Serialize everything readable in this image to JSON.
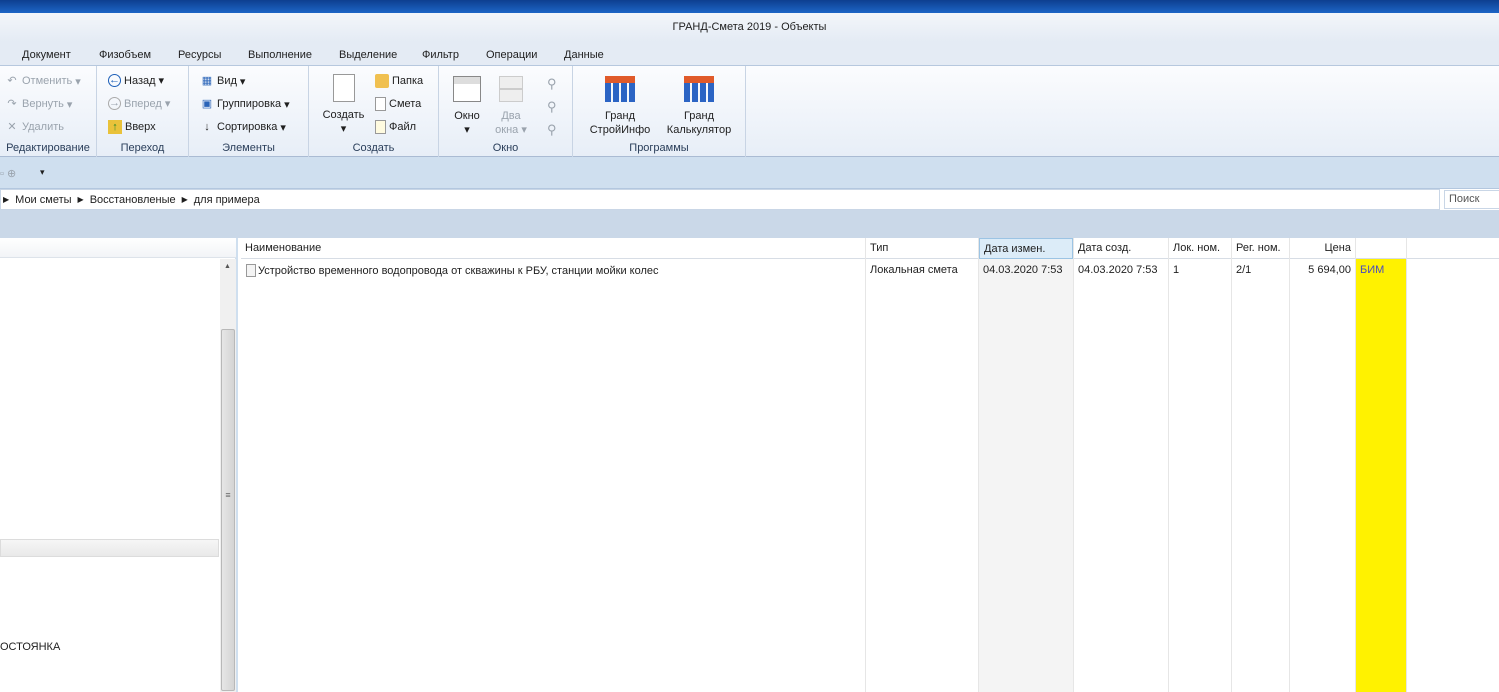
{
  "window": {
    "title": "ГРАНД-Смета 2019 - Объекты"
  },
  "menu": [
    "Документ",
    "Физобъем",
    "Ресурсы",
    "Выполнение",
    "Выделение",
    "Фильтр",
    "Операции",
    "Данные"
  ],
  "ribbon": {
    "edit": {
      "label": "Редактирование",
      "undo": "Отменить",
      "redo": "Вернуть",
      "delete": "Удалить"
    },
    "nav": {
      "label": "Переход",
      "back": "Назад",
      "forward": "Вперед",
      "up": "Вверх"
    },
    "elements": {
      "label": "Элементы",
      "view": "Вид",
      "group": "Группировка",
      "sort": "Сортировка"
    },
    "create": {
      "label": "Создать",
      "create": "Создать",
      "folder": "Папка",
      "estimate": "Смета",
      "file": "Файл"
    },
    "window": {
      "label": "Окно",
      "window": "Окно",
      "two1": "Два",
      "two2": "окна"
    },
    "programs": {
      "label": "Программы",
      "p1a": "Гранд",
      "p1b": "СтройИнфо",
      "p2a": "Гранд",
      "p2b": "Калькулятор"
    }
  },
  "breadcrumb": [
    "Мои сметы",
    "Восстановленые",
    "для примера"
  ],
  "search": {
    "placeholder": "Поиск"
  },
  "left_panel": {
    "item": "ОСТОЯНКА"
  },
  "grid": {
    "columns": [
      "Наименование",
      "Тип",
      "Дата измен.",
      "Дата созд.",
      "Лок. ном.",
      "Рег. ном.",
      "Цена",
      ""
    ],
    "rows": [
      {
        "name": "Устройство временного водопровода от скважины к РБУ, станции мойки колес",
        "type": "Локальная смета",
        "modified": "04.03.2020 7:53",
        "created": "04.03.2020 7:53",
        "loc": "1",
        "reg": "2/1",
        "price": "5 694,00",
        "tag": "БИМ"
      }
    ]
  },
  "colors": {
    "highlight": "#fff200",
    "sorted_col": "#f4f4f4"
  }
}
